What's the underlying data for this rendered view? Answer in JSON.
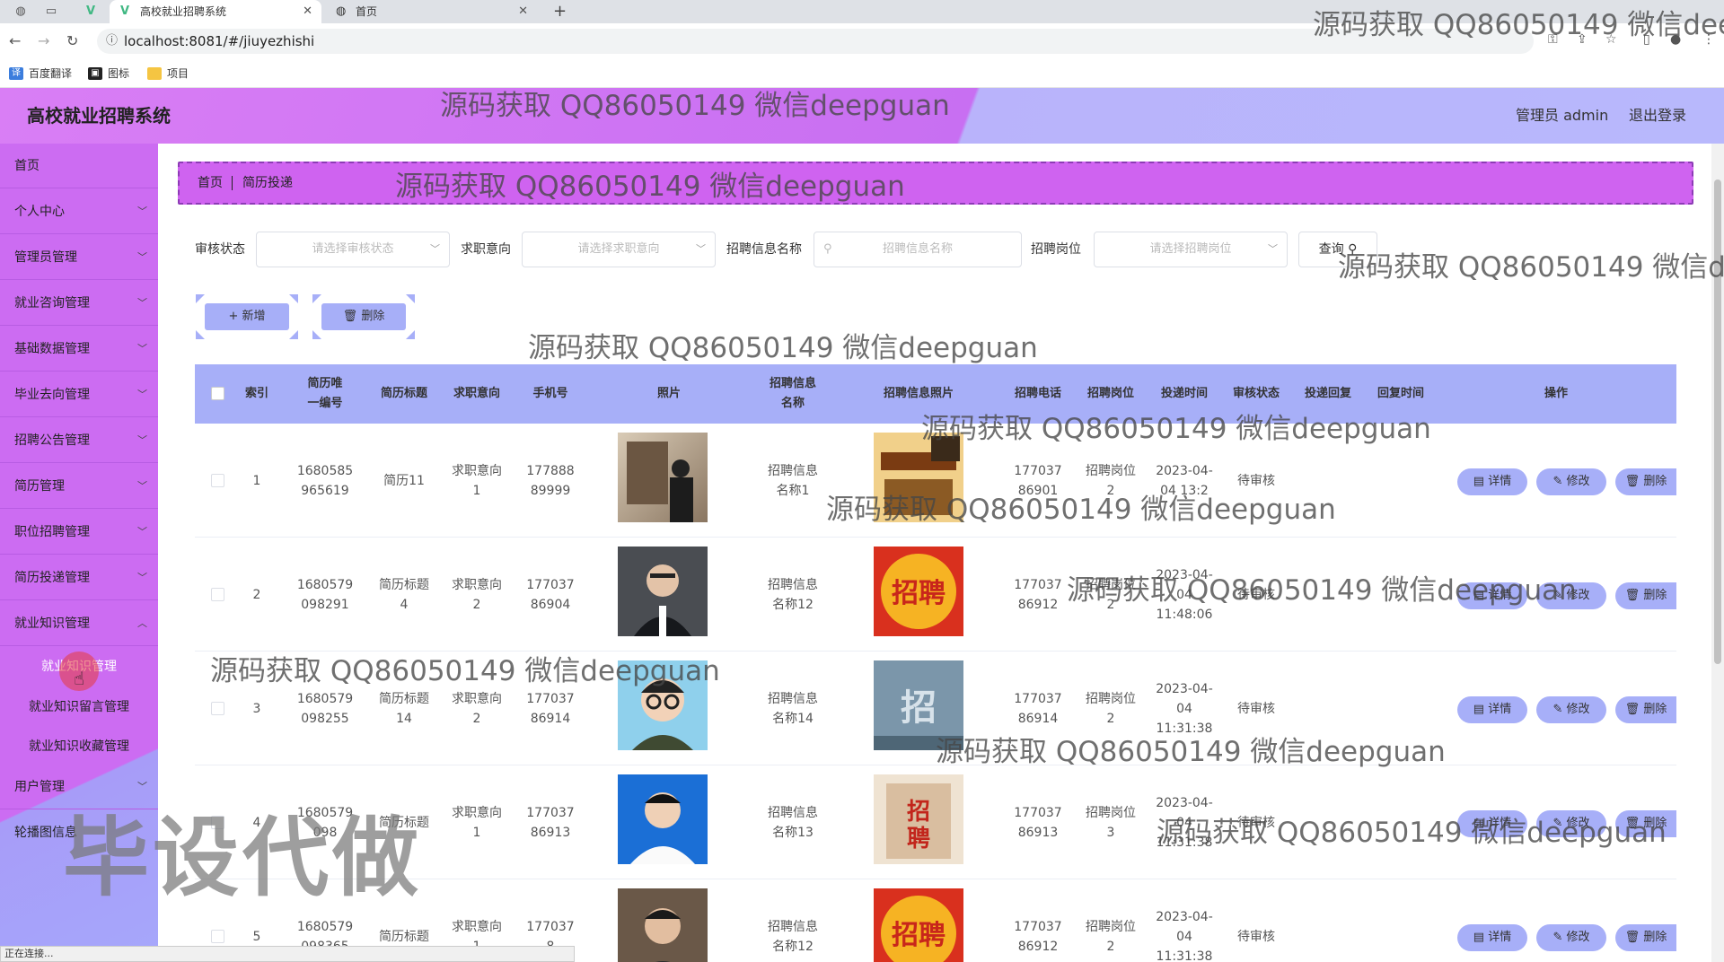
{
  "browser": {
    "tabs": [
      {
        "title": "高校就业招聘系统",
        "active": true
      },
      {
        "title": "首页",
        "active": false
      }
    ],
    "url": "localhost:8081/#/jiuyezhishi",
    "bookmarks": [
      "百度翻译",
      "图标",
      "项目"
    ]
  },
  "header": {
    "title": "高校就业招聘系统",
    "admin_label": "管理员 admin",
    "logout_label": "退出登录"
  },
  "sidebar": {
    "items": [
      {
        "label": "首页",
        "has_arrow": false
      },
      {
        "label": "个人中心",
        "has_arrow": true
      },
      {
        "label": "管理员管理",
        "has_arrow": true
      },
      {
        "label": "就业咨询管理",
        "has_arrow": true
      },
      {
        "label": "基础数据管理",
        "has_arrow": true
      },
      {
        "label": "毕业去向管理",
        "has_arrow": true
      },
      {
        "label": "招聘公告管理",
        "has_arrow": true
      },
      {
        "label": "简历管理",
        "has_arrow": true
      },
      {
        "label": "职位招聘管理",
        "has_arrow": true
      },
      {
        "label": "简历投递管理",
        "has_arrow": true
      },
      {
        "label": "就业知识管理",
        "has_arrow": true
      }
    ],
    "subitems": [
      {
        "label": "就业知识管理",
        "active": true
      },
      {
        "label": "就业知识留言管理",
        "active": false
      },
      {
        "label": "就业知识收藏管理",
        "active": false
      }
    ],
    "bottom_items": [
      {
        "label": "用户管理"
      },
      {
        "label": "轮播图信息"
      }
    ]
  },
  "breadcrumb": {
    "home": "首页",
    "current": "简历投递"
  },
  "filters": {
    "status_label": "审核状态",
    "status_placeholder": "请选择审核状态",
    "intent_label": "求职意向",
    "intent_placeholder": "请选择求职意向",
    "job_name_label": "招聘信息名称",
    "job_name_placeholder": "招聘信息名称",
    "post_label": "招聘岗位",
    "post_placeholder": "请选择招聘岗位",
    "query_label": "查询"
  },
  "actions": {
    "add_label": "+ 新增",
    "delete_label": "删除"
  },
  "table": {
    "columns": [
      "索引",
      "简历唯一编号",
      "简历标题",
      "求职意向",
      "手机号",
      "照片",
      "招聘信息名称",
      "招聘信息照片",
      "招聘电话",
      "招聘岗位",
      "投递时间",
      "审核状态",
      "投递回复",
      "回复时间",
      "操作"
    ],
    "row_actions": {
      "detail": "详情",
      "edit": "修改",
      "delete": "删除"
    },
    "rows": [
      {
        "index": "1",
        "resume_no": "1680585965619",
        "title": "简历11",
        "intent": "求职意向1",
        "phone": "17788889999",
        "photo": "photo-man-painting",
        "job_name": "招聘信息名称1",
        "job_photo": "poster-join-us",
        "job_phone": "17703786901",
        "post": "招聘岗位2",
        "time": "2023-04-04 13:2",
        "status": "待审核",
        "reply": "",
        "reply_time": ""
      },
      {
        "index": "2",
        "resume_no": "1680579098291",
        "title": "简历标题4",
        "intent": "求职意向2",
        "phone": "17703786904",
        "photo": "photo-man-suit",
        "job_name": "招聘信息名称12",
        "job_photo": "poster-zhaopin-red",
        "job_phone": "17703786912",
        "post": "招聘岗位2",
        "time": "2023-04-04 11:48:06",
        "status": "待审核",
        "reply": "",
        "reply_time": ""
      },
      {
        "index": "3",
        "resume_no": "1680579098255",
        "title": "简历标题14",
        "intent": "求职意向2",
        "phone": "17703786914",
        "photo": "avatar-cartoon",
        "job_name": "招聘信息名称14",
        "job_photo": "poster-zhaopin-blue",
        "job_phone": "17703786914",
        "post": "招聘岗位2",
        "time": "2023-04-04 11:31:38",
        "status": "待审核",
        "reply": "",
        "reply_time": ""
      },
      {
        "index": "4",
        "resume_no": "1680579098",
        "title": "简历标题",
        "intent": "求职意向1",
        "phone": "17703786913",
        "photo": "photo-man-blue",
        "job_name": "招聘信息名称13",
        "job_photo": "poster-zhaopin-paper",
        "job_phone": "17703786913",
        "post": "招聘岗位3",
        "time": "2023-04-04 11:31:38",
        "status": "待审核",
        "reply": "",
        "reply_time": ""
      },
      {
        "index": "5",
        "resume_no": "1680579098365",
        "title": "简历标题",
        "intent": "求职意向1",
        "phone": "1770378",
        "photo": "photo-man-smile",
        "job_name": "招聘信息名称12",
        "job_photo": "poster-zhaopin-red",
        "job_phone": "17703786912",
        "post": "招聘岗位2",
        "time": "2023-04-04 11:31:38",
        "status": "待审核",
        "reply": "",
        "reply_time": ""
      }
    ]
  },
  "watermark_text": "源码获取 QQ86050149 微信deepguan",
  "big_watermark": "毕设代做",
  "status_text": "正在连接...",
  "colors": {
    "purple": "#cc6cf2",
    "lavender": "#a7aff8",
    "border": "#8d3bb6"
  }
}
